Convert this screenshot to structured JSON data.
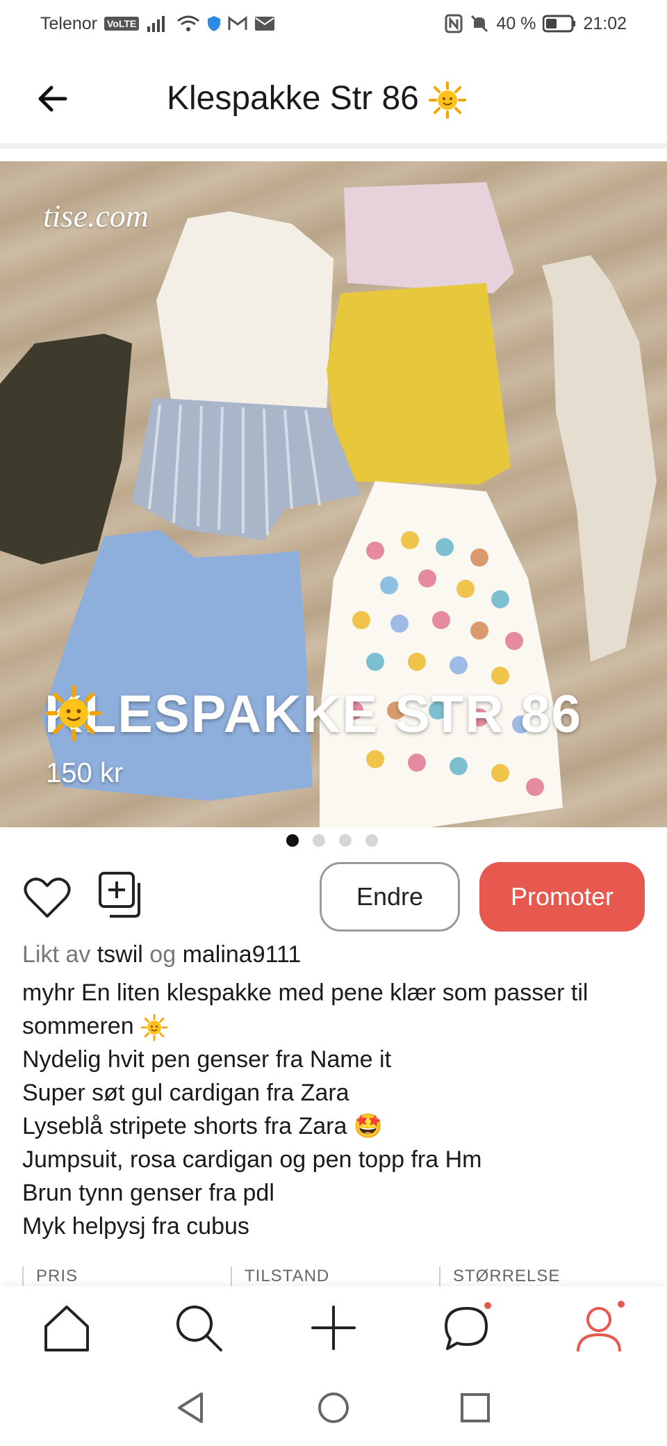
{
  "status_bar": {
    "carrier": "Telenor",
    "volte": "VoLTE",
    "battery": "40 %",
    "time": "21:02"
  },
  "header": {
    "title": "Klespakke Str 86"
  },
  "photo": {
    "watermark": "tise.com",
    "overlay_title": "KLESPAKKE STR 86",
    "overlay_price": "150 kr",
    "page_count": 4,
    "active_page": 1
  },
  "actions": {
    "edit_label": "Endre",
    "promote_label": "Promoter",
    "promote_color": "#e7584e"
  },
  "likes": {
    "prefix": "Likt av",
    "user1": "tswil",
    "connector": "og",
    "user2": "malina9111"
  },
  "description": {
    "author": "myhr",
    "lines": [
      "En liten klespakke med pene klær som passer til sommeren",
      "Nydelig hvit pen genser fra Name it",
      "Super søt gul cardigan fra Zara",
      "Lyseblå stripete shorts fra Zara 🤩",
      "Jumpsuit, rosa cardigan og pen topp fra Hm",
      "Brun tynn genser fra pdl",
      "Myk helpysj fra cubus"
    ]
  },
  "info": {
    "price_label": "PRIS",
    "condition_label": "TILSTAND",
    "size_label": "STØRRELSE"
  },
  "bottom_nav": [
    "home-icon",
    "search-icon",
    "add-icon",
    "chat-icon",
    "profile-icon"
  ]
}
